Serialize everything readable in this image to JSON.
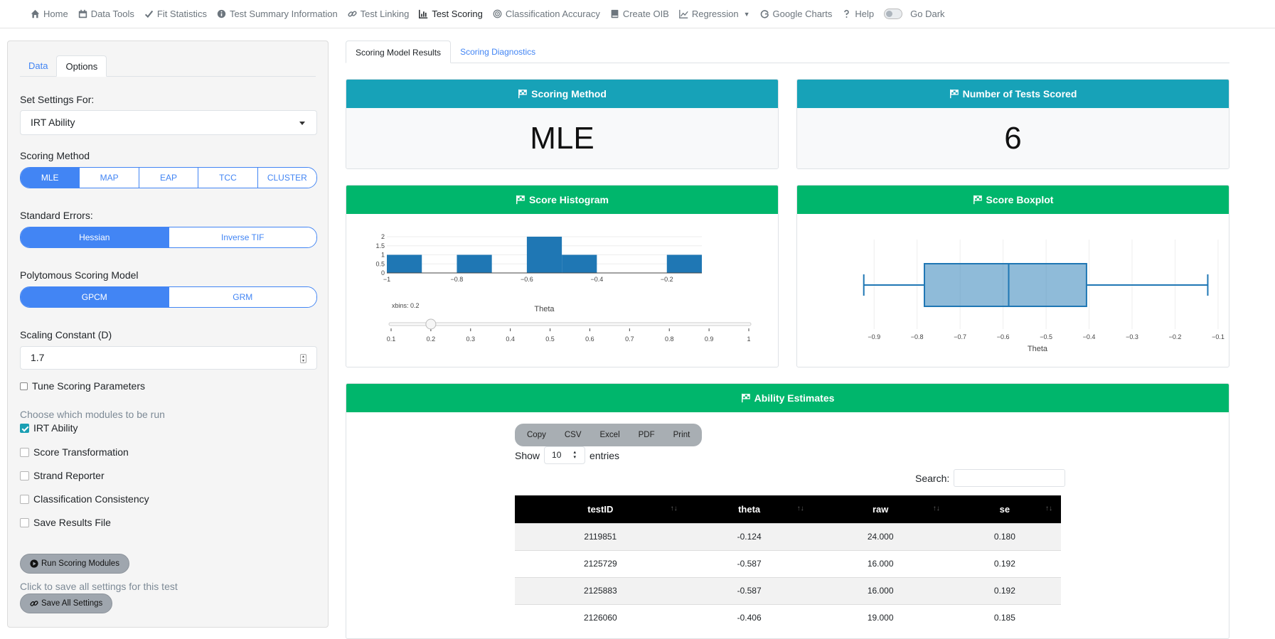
{
  "nav": {
    "items": [
      {
        "label": "Home",
        "icon": "home-icon"
      },
      {
        "label": "Data Tools",
        "icon": "calendar-icon"
      },
      {
        "label": "Fit Statistics",
        "icon": "check-icon"
      },
      {
        "label": "Test Summary Information",
        "icon": "info-icon"
      },
      {
        "label": "Test Linking",
        "icon": "link-icon"
      },
      {
        "label": "Test Scoring",
        "icon": "bar-chart-icon"
      },
      {
        "label": "Classification Accuracy",
        "icon": "bullseye-icon"
      },
      {
        "label": "Create OIB",
        "icon": "book-icon"
      },
      {
        "label": "Regression",
        "icon": "line-chart-icon"
      },
      {
        "label": "Google Charts",
        "icon": "google-icon"
      },
      {
        "label": "Help",
        "icon": "question-icon"
      },
      {
        "label": "Go Dark",
        "icon": "toggle-icon"
      }
    ],
    "active": "Test Scoring"
  },
  "sidebar": {
    "tabs": [
      "Data",
      "Options"
    ],
    "active_tab": "Options",
    "settings_for_label": "Set Settings For:",
    "settings_for_value": "IRT Ability",
    "scoring_method_label": "Scoring Method",
    "scoring_methods": [
      "MLE",
      "MAP",
      "EAP",
      "TCC",
      "CLUSTER"
    ],
    "scoring_method_selected": "MLE",
    "std_errors_label": "Standard Errors:",
    "std_errors": [
      "Hessian",
      "Inverse TIF"
    ],
    "std_errors_selected": "Hessian",
    "poly_label": "Polytomous Scoring Model",
    "poly_models": [
      "GPCM",
      "GRM"
    ],
    "poly_selected": "GPCM",
    "scaling_label": "Scaling Constant (D)",
    "scaling_value": "1.7",
    "tune_label": "Tune Scoring Parameters",
    "modules_label": "Choose which modules to be run",
    "modules": [
      {
        "label": "IRT Ability",
        "checked": true
      },
      {
        "label": "Score Transformation",
        "checked": false
      },
      {
        "label": "Strand Reporter",
        "checked": false
      },
      {
        "label": "Classification Consistency",
        "checked": false
      },
      {
        "label": "Save Results File",
        "checked": false
      }
    ],
    "run_button": "Run Scoring Modules",
    "save_hint": "Click to save all settings for this test",
    "save_button": "Save All Settings"
  },
  "main": {
    "tabs": [
      "Scoring Model Results",
      "Scoring Diagnostics"
    ],
    "active_tab": "Scoring Model Results",
    "cards": {
      "scoring_method": {
        "title": "Scoring Method",
        "value": "MLE"
      },
      "tests_scored": {
        "title": "Number of Tests Scored",
        "value": "6"
      },
      "histogram": {
        "title": "Score Histogram"
      },
      "boxplot": {
        "title": "Score Boxplot"
      },
      "ability": {
        "title": "Ability Estimates"
      }
    },
    "colors": {
      "teal": "#17a2b8",
      "green": "#00b66c",
      "plot_blue": "#1f77b4"
    }
  },
  "chart_data": [
    {
      "type": "bar",
      "title": "Score Histogram",
      "xlabel": "Theta",
      "ylabel": "",
      "bins": [
        {
          "x0": -1.0,
          "x1": -0.9,
          "count": 1
        },
        {
          "x0": -0.9,
          "x1": -0.8,
          "count": 0
        },
        {
          "x0": -0.8,
          "x1": -0.7,
          "count": 1
        },
        {
          "x0": -0.7,
          "x1": -0.6,
          "count": 0
        },
        {
          "x0": -0.6,
          "x1": -0.5,
          "count": 2
        },
        {
          "x0": -0.5,
          "x1": -0.4,
          "count": 1
        },
        {
          "x0": -0.4,
          "x1": -0.3,
          "count": 0
        },
        {
          "x0": -0.3,
          "x1": -0.2,
          "count": 0
        },
        {
          "x0": -0.2,
          "x1": -0.1,
          "count": 1
        }
      ],
      "xlim": [
        -1.0,
        -0.1
      ],
      "ylim": [
        0,
        2
      ],
      "x_ticks": [
        "−1",
        "−0.8",
        "−0.6",
        "−0.4",
        "−0.2"
      ],
      "x_tick_values": [
        -1.0,
        -0.8,
        -0.6,
        -0.4,
        -0.2
      ],
      "y_ticks": [
        "0",
        "0.5",
        "1",
        "1.5",
        "2"
      ],
      "y_tick_values": [
        0,
        0.5,
        1,
        1.5,
        2
      ],
      "slider": {
        "label": "xbins: 0.2",
        "value": 0.2,
        "min": 0.1,
        "max": 1.0,
        "ticks": [
          "0.1",
          "0.2",
          "0.3",
          "0.4",
          "0.5",
          "0.6",
          "0.7",
          "0.8",
          "0.9",
          "1"
        ]
      }
    },
    {
      "type": "box",
      "title": "Score Boxplot",
      "xlabel": "Theta",
      "min": -0.924,
      "q1": -0.783,
      "median": -0.587,
      "q3": -0.406,
      "max": -0.124,
      "xlim": [
        -0.95,
        -0.09
      ],
      "x_ticks": [
        "−0.9",
        "−0.8",
        "−0.7",
        "−0.6",
        "−0.5",
        "−0.4",
        "−0.3",
        "−0.2",
        "−0.1"
      ],
      "x_tick_values": [
        -0.9,
        -0.8,
        -0.7,
        -0.6,
        -0.5,
        -0.4,
        -0.3,
        -0.2,
        -0.1
      ]
    }
  ],
  "table": {
    "buttons": [
      "Copy",
      "CSV",
      "Excel",
      "PDF",
      "Print"
    ],
    "show_label": "Show",
    "entries_value": "10",
    "entries_label": "entries",
    "search_label": "Search:",
    "columns": [
      "testID",
      "theta",
      "raw",
      "se"
    ],
    "rows": [
      [
        "2119851",
        "-0.124",
        "24.000",
        "0.180"
      ],
      [
        "2125729",
        "-0.587",
        "16.000",
        "0.192"
      ],
      [
        "2125883",
        "-0.587",
        "16.000",
        "0.192"
      ],
      [
        "2126060",
        "-0.406",
        "19.000",
        "0.185"
      ]
    ]
  }
}
